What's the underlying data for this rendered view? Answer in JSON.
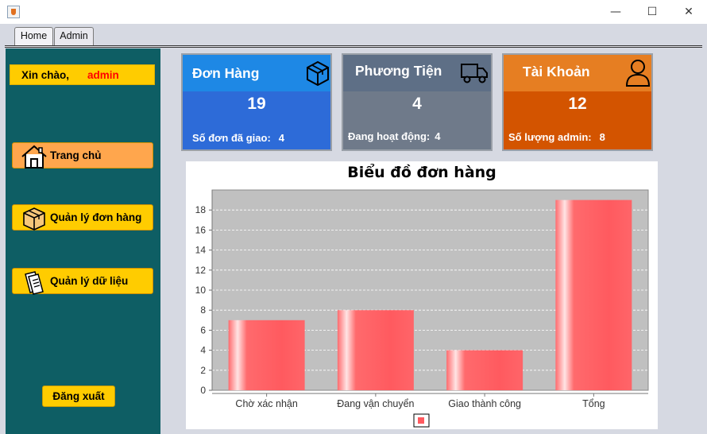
{
  "window": {
    "minimize_glyph": "—",
    "maximize_glyph": "☐",
    "close_glyph": "✕"
  },
  "tabs": [
    {
      "label": "Home",
      "active": true
    },
    {
      "label": "Admin",
      "active": false
    }
  ],
  "sidebar": {
    "greeting_label": "Xin chào,",
    "username": "admin",
    "items": [
      {
        "label": "Trang chủ",
        "icon": "home-icon",
        "color": "#ffa64d"
      },
      {
        "label": "Quản lý đơn hàng",
        "icon": "package-icon",
        "color": "#ffcc00"
      },
      {
        "label": "Quản lý dữ liệu",
        "icon": "documents-icon",
        "color": "#ffcc00"
      }
    ],
    "logout_label": "Đăng xuất"
  },
  "cards": {
    "orders": {
      "title": "Đơn Hàng",
      "count": "19",
      "footer_label": "Số đơn đã giao:",
      "footer_value": "4",
      "icon": "package-icon",
      "head_color": "#1e88e5",
      "body_color": "#2d6bd8"
    },
    "vehicles": {
      "title": "Phương Tiện",
      "count": "4",
      "footer_label": "Đang hoạt động:",
      "footer_value": "4",
      "icon": "truck-icon",
      "head_color": "#5e6f86",
      "body_color": "#6f7a8a"
    },
    "accounts": {
      "title": "Tài Khoản",
      "count": "12",
      "footer_label": "Số lượng admin:",
      "footer_value": "8",
      "icon": "user-icon",
      "head_color": "#e67e22",
      "body_color": "#d35400"
    }
  },
  "chart_data": {
    "type": "bar",
    "title": "Biểu đồ đơn hàng",
    "xlabel": "",
    "ylabel": "",
    "categories": [
      "Chờ xác nhận",
      "Đang vận chuyển",
      "Giao thành công",
      "Tổng"
    ],
    "values": [
      7,
      8,
      4,
      19
    ],
    "ylim": [
      0,
      20
    ],
    "yticks": [
      0,
      2,
      4,
      6,
      8,
      10,
      12,
      14,
      16,
      18
    ],
    "grid": true,
    "bar_color": "#ff5a5f",
    "plot_background": "#c0c0c0",
    "legend": {
      "placement": "bottom",
      "entries": [
        ""
      ]
    }
  }
}
